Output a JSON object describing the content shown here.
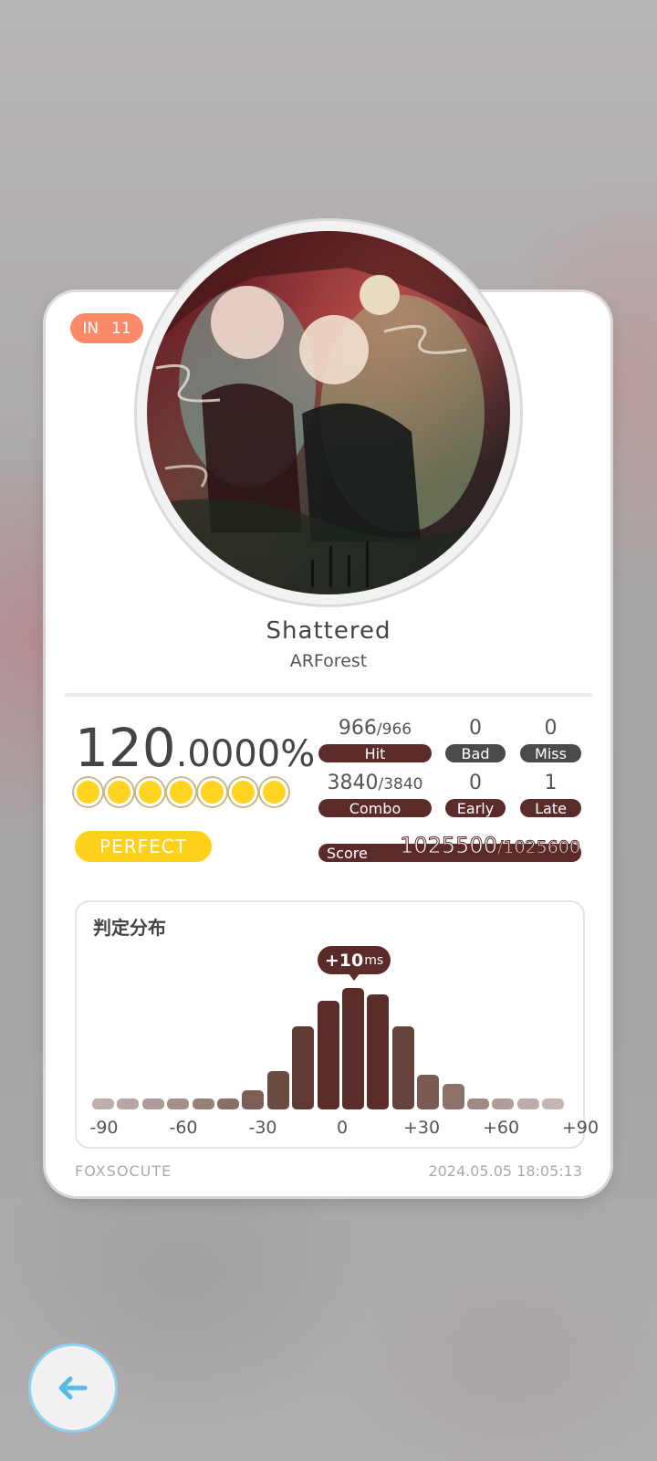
{
  "level": {
    "difficulty": "IN",
    "number": "11"
  },
  "song": {
    "title": "Shattered",
    "artist": "ARForest"
  },
  "result": {
    "accuracy_int": "120",
    "accuracy_dec": ".0000%",
    "rank": "PERFECT",
    "dots_filled": 7
  },
  "stats": {
    "hit": {
      "value": "966",
      "total": "/966",
      "label": "Hit"
    },
    "bad": {
      "value": "0",
      "label": "Bad"
    },
    "miss": {
      "value": "0",
      "label": "Miss"
    },
    "combo": {
      "value": "3840",
      "total": "/3840",
      "label": "Combo"
    },
    "early": {
      "value": "0",
      "label": "Early"
    },
    "late": {
      "value": "1",
      "label": "Late"
    },
    "score": {
      "label": "Score",
      "value": "1025500",
      "max": "/1025600"
    }
  },
  "chart_data": {
    "type": "bar",
    "title": "判定分布",
    "offset_label": "+10",
    "offset_unit": "ms",
    "tick_labels": [
      "-90",
      "-60",
      "-30",
      "0",
      "+30",
      "+60",
      "+90"
    ],
    "values": [
      1,
      1,
      1,
      1,
      1,
      1.5,
      3,
      6,
      13,
      17,
      19,
      18,
      13,
      5.5,
      4,
      1.5,
      1,
      1,
      1
    ],
    "colors": [
      "#bfafac",
      "#b7a6a2",
      "#ae9b97",
      "#a48f8a",
      "#98807a",
      "#8a6f68",
      "#7c5e56",
      "#6c4b43",
      "#5e3a33",
      "#5b2d2a",
      "#5b2d2a",
      "#5b2d2a",
      "#66423b",
      "#7a5a52",
      "#8d716a",
      "#a08984",
      "#b09d98",
      "#bcaca8",
      "#c4b6b3"
    ]
  },
  "footer": {
    "player": "FOXSOCUTE",
    "datetime": "2024.05.05 18:05:13"
  },
  "nav": {
    "back_icon": "arrow-left-icon"
  }
}
